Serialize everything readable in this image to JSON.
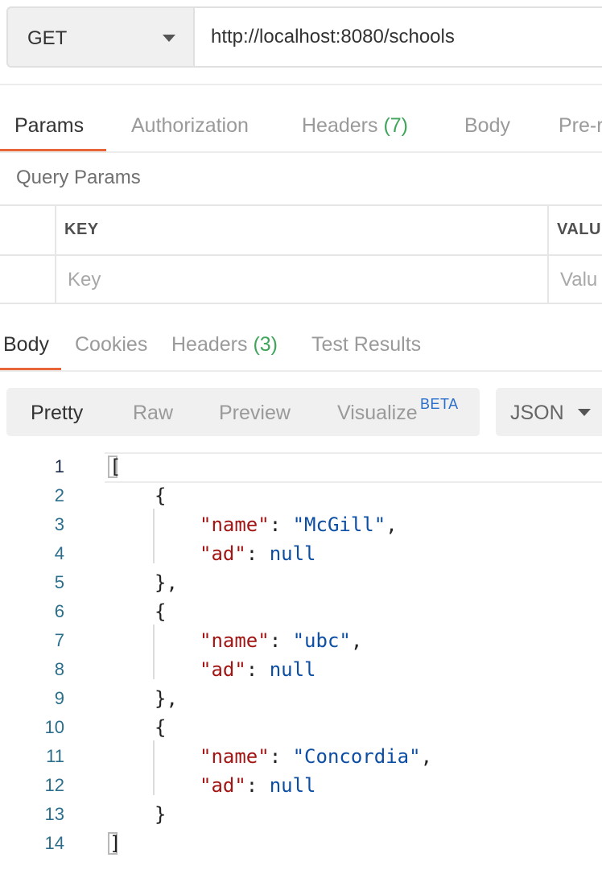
{
  "request": {
    "method": "GET",
    "url": "http://localhost:8080/schools"
  },
  "request_tabs": [
    {
      "label": "Params",
      "count": ""
    },
    {
      "label": "Authorization",
      "count": ""
    },
    {
      "label": "Headers",
      "count": "(7)"
    },
    {
      "label": "Body",
      "count": ""
    },
    {
      "label": "Pre-r",
      "count": ""
    }
  ],
  "query_params": {
    "title": "Query Params",
    "columns": [
      "KEY",
      "VALUI"
    ],
    "placeholders": [
      "Key",
      "Valu"
    ]
  },
  "response_tabs": [
    {
      "label": "Body",
      "count": ""
    },
    {
      "label": "Cookies",
      "count": ""
    },
    {
      "label": "Headers",
      "count": "(3)"
    },
    {
      "label": "Test Results",
      "count": ""
    }
  ],
  "view_modes": [
    "Pretty",
    "Raw",
    "Preview",
    "Visualize"
  ],
  "beta_badge": "BETA",
  "format": "JSON",
  "active_tab_color": "#e8653a",
  "count_color": "#3fa55a",
  "response_lines": [
    {
      "num": "1",
      "open": "[",
      "key": "",
      "colon": "",
      "val": "",
      "close": ""
    },
    {
      "num": "2",
      "open": "{",
      "key": "",
      "colon": "",
      "val": "",
      "close": ""
    },
    {
      "num": "3",
      "open": "",
      "key": "\"name\"",
      "colon": ": ",
      "val": "\"McGill\"",
      "close": ","
    },
    {
      "num": "4",
      "open": "",
      "key": "\"ad\"",
      "colon": ": ",
      "val": "null",
      "close": ""
    },
    {
      "num": "5",
      "open": "},",
      "key": "",
      "colon": "",
      "val": "",
      "close": ""
    },
    {
      "num": "6",
      "open": "{",
      "key": "",
      "colon": "",
      "val": "",
      "close": ""
    },
    {
      "num": "7",
      "open": "",
      "key": "\"name\"",
      "colon": ": ",
      "val": "\"ubc\"",
      "close": ","
    },
    {
      "num": "8",
      "open": "",
      "key": "\"ad\"",
      "colon": ": ",
      "val": "null",
      "close": ""
    },
    {
      "num": "9",
      "open": "},",
      "key": "",
      "colon": "",
      "val": "",
      "close": ""
    },
    {
      "num": "10",
      "open": "{",
      "key": "",
      "colon": "",
      "val": "",
      "close": ""
    },
    {
      "num": "11",
      "open": "",
      "key": "\"name\"",
      "colon": ": ",
      "val": "\"Concordia\"",
      "close": ","
    },
    {
      "num": "12",
      "open": "",
      "key": "\"ad\"",
      "colon": ": ",
      "val": "null",
      "close": ""
    },
    {
      "num": "13",
      "open": "}",
      "key": "",
      "colon": "",
      "val": "",
      "close": ""
    },
    {
      "num": "14",
      "open": "]",
      "key": "",
      "colon": "",
      "val": "",
      "close": ""
    }
  ]
}
